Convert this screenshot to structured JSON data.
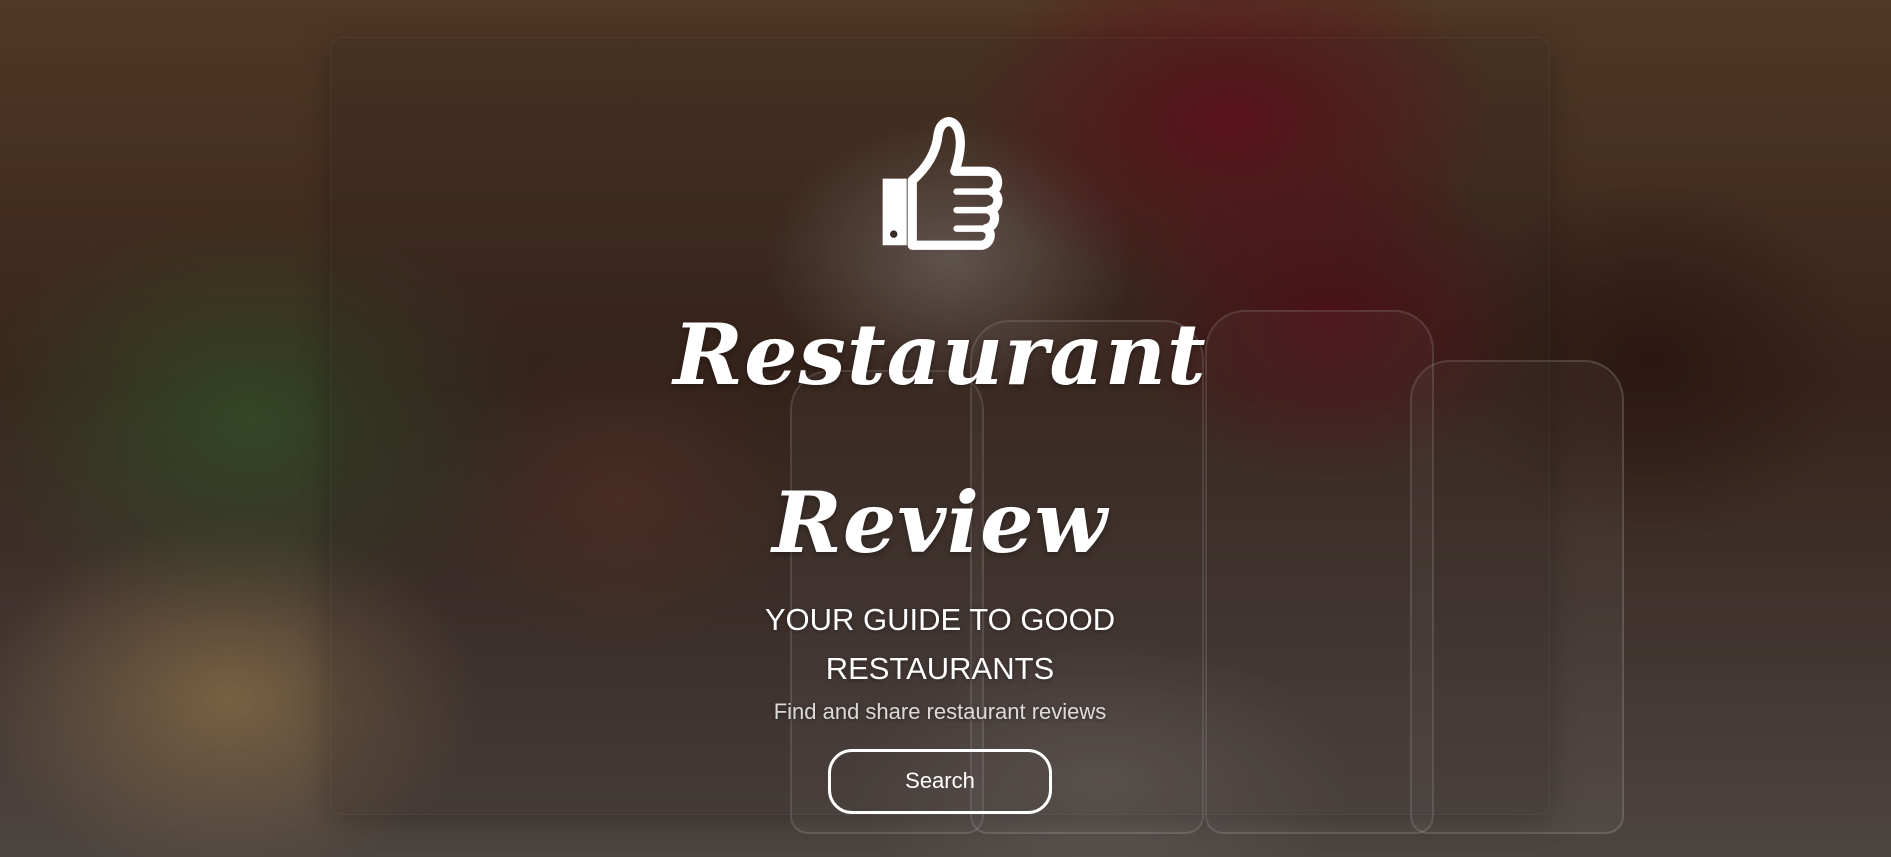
{
  "hero": {
    "title_line1": "Restaurant",
    "title_line2": "Review",
    "tagline": "YOUR GUIDE TO GOOD RESTAURANTS",
    "subtitle": "Find and share restaurant reviews",
    "search_label": "Search",
    "icon": "thumbs-up-icon"
  },
  "colors": {
    "text": "#ffffff",
    "button_border": "#ffffff"
  }
}
